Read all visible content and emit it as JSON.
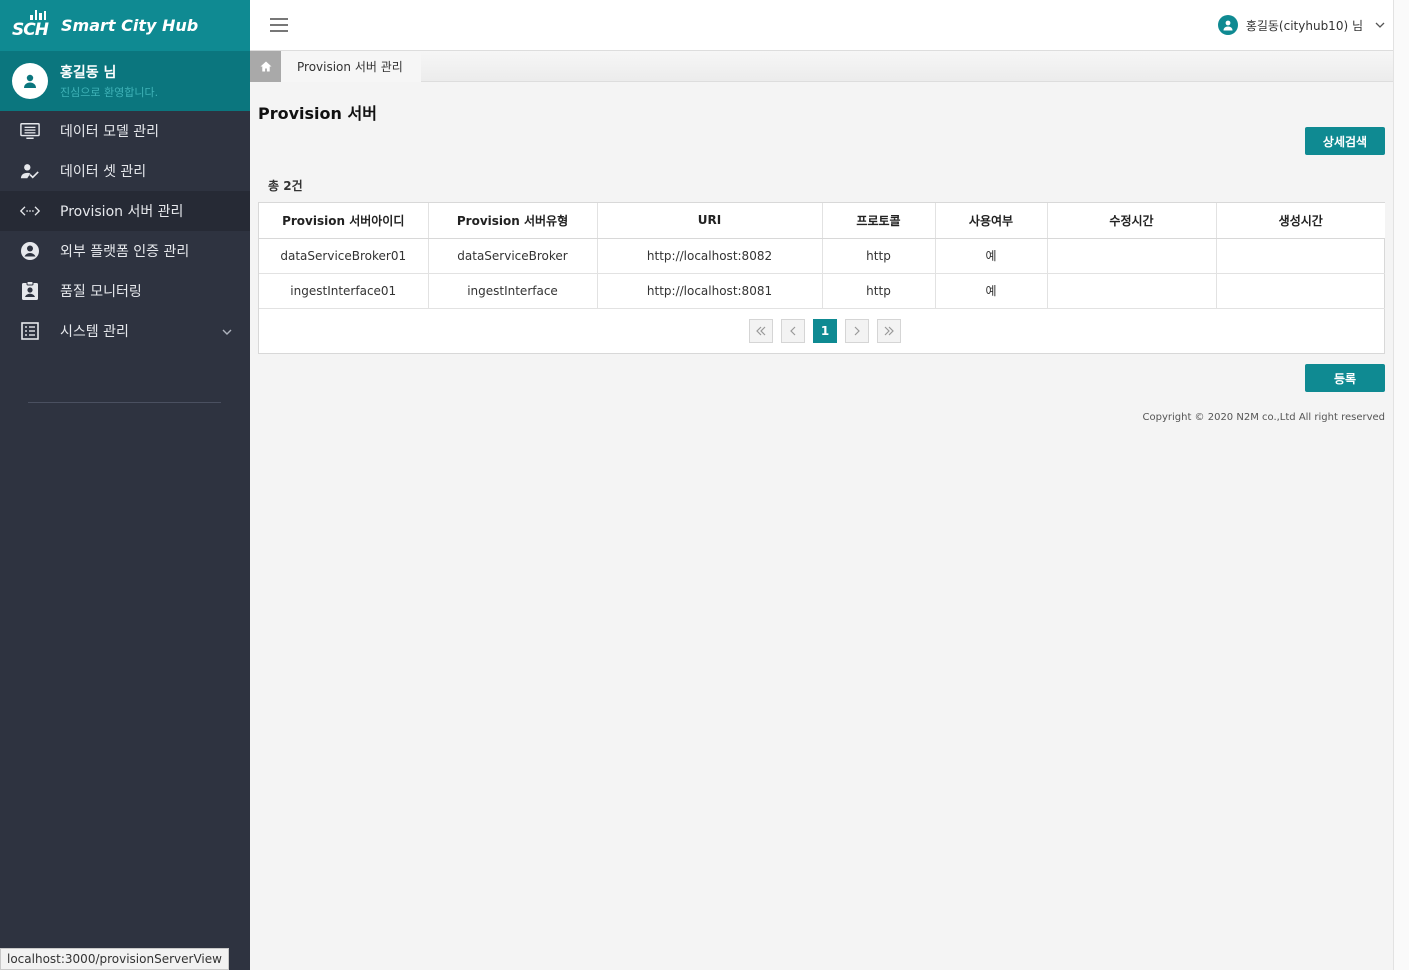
{
  "app": {
    "logo_text": "SCH",
    "name": "Smart City Hub"
  },
  "profile": {
    "name": "홍길동 님",
    "welcome": "진심으로 환영합니다."
  },
  "sidebar": {
    "items": [
      {
        "label": "데이터 모델 관리",
        "icon": "monitor-list-icon"
      },
      {
        "label": "데이터 셋 관리",
        "icon": "user-check-icon"
      },
      {
        "label": "Provision 서버 관리",
        "icon": "code-arrows-icon",
        "active": true
      },
      {
        "label": "외부 플랫폼 인증 관리",
        "icon": "user-circle-icon"
      },
      {
        "label": "품질 모니터링",
        "icon": "clipboard-user-icon"
      },
      {
        "label": "시스템 관리",
        "icon": "list-box-icon",
        "expandable": true
      }
    ]
  },
  "header": {
    "user": "홍길동(cityhub10) 님"
  },
  "breadcrumb": {
    "current": "Provision 서버 관리"
  },
  "main": {
    "title": "Provision 서버",
    "detail_search_label": "상세검색",
    "total": "총 2건",
    "register_label": "등록",
    "columns": [
      "Provision 서버아이디",
      "Provision 서버유형",
      "URI",
      "프로토콜",
      "사용여부",
      "수정시간",
      "생성시간"
    ],
    "rows": [
      [
        "dataServiceBroker01",
        "dataServiceBroker",
        "http://localhost:8082",
        "http",
        "예",
        "",
        ""
      ],
      [
        "ingestInterface01",
        "ingestInterface",
        "http://localhost:8081",
        "http",
        "예",
        "",
        ""
      ]
    ],
    "pagination": {
      "current_page": "1"
    }
  },
  "footer": {
    "copyright": "Copyright © 2020 N2M co.,Ltd All right reserved"
  },
  "statusbar": {
    "url": "localhost:3000/provisionServerView"
  },
  "colors": {
    "brand": "#0f8a92",
    "sidebar": "#2e3340",
    "profile_bg": "#0b767e"
  }
}
